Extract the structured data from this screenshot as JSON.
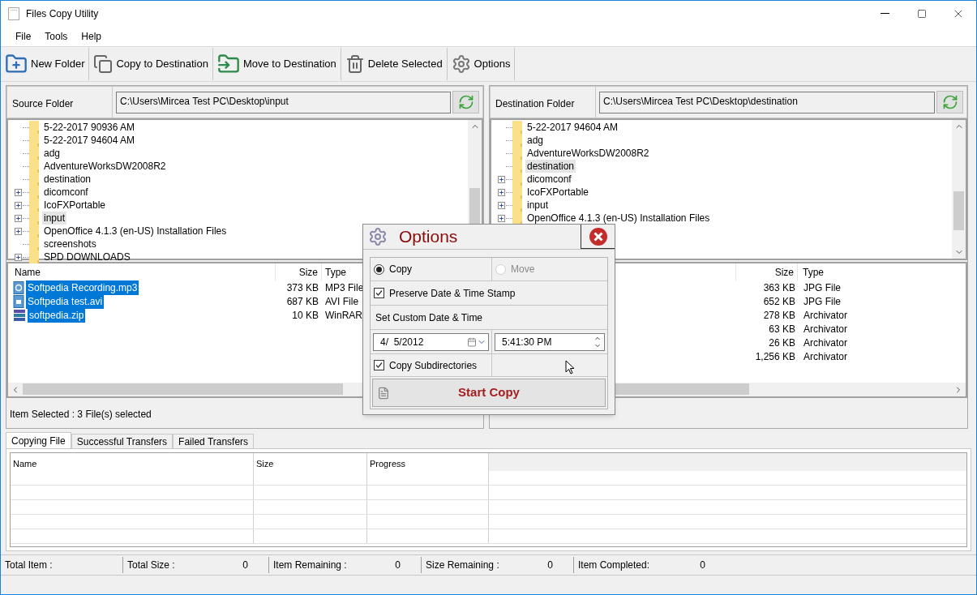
{
  "window": {
    "title": "Files Copy Utility"
  },
  "menu": [
    "File",
    "Tools",
    "Help"
  ],
  "toolbar": [
    {
      "label": "New Folder",
      "kind": "new-folder"
    },
    {
      "label": "Copy to Destination",
      "kind": "copy"
    },
    {
      "label": "Move to Destination",
      "kind": "move"
    },
    {
      "label": "Delete Selected",
      "kind": "delete"
    },
    {
      "label": "Options",
      "kind": "options"
    }
  ],
  "source": {
    "label": "Source Folder",
    "path": "C:\\Users\\Mircea Test PC\\Desktop\\input",
    "tree": [
      {
        "label": "5-22-2017 90936 AM",
        "expandable": false,
        "selected": false
      },
      {
        "label": "5-22-2017 94604 AM",
        "expandable": false,
        "selected": false
      },
      {
        "label": "adg",
        "expandable": false,
        "selected": false
      },
      {
        "label": "AdventureWorksDW2008R2",
        "expandable": false,
        "selected": false
      },
      {
        "label": "destination",
        "expandable": false,
        "selected": false
      },
      {
        "label": "dicomconf",
        "expandable": true,
        "selected": false
      },
      {
        "label": "IcoFXPortable",
        "expandable": true,
        "selected": false
      },
      {
        "label": "input",
        "expandable": true,
        "selected": true
      },
      {
        "label": "OpenOffice 4.1.3 (en-US) Installation Files",
        "expandable": true,
        "selected": false
      },
      {
        "label": "screenshots",
        "expandable": false,
        "selected": false
      },
      {
        "label": "SPD DOWNLOADS",
        "expandable": true,
        "selected": false
      }
    ],
    "files": {
      "columns": [
        "Name",
        "Size",
        "Type"
      ],
      "rows": [
        {
          "name": "Softpedia Recording.mp3",
          "size": "373 KB",
          "type": "MP3 File",
          "kind": "audio",
          "selected": true
        },
        {
          "name": "Softpedia test.avi",
          "size": "687 KB",
          "type": "AVI File",
          "kind": "video",
          "selected": true
        },
        {
          "name": "softpedia.zip",
          "size": "10 KB",
          "type": "WinRAR",
          "kind": "archive",
          "selected": true
        }
      ]
    },
    "status": "Item Selected :  3 File(s) selected"
  },
  "destination": {
    "label": "Destination Folder",
    "path": "C:\\Users\\Mircea Test PC\\Desktop\\destination",
    "tree": [
      {
        "label": "5-22-2017 94604 AM",
        "expandable": false,
        "selected": false
      },
      {
        "label": "adg",
        "expandable": false,
        "selected": false
      },
      {
        "label": "AdventureWorksDW2008R2",
        "expandable": false,
        "selected": false
      },
      {
        "label": "destination",
        "expandable": false,
        "selected": true
      },
      {
        "label": "dicomconf",
        "expandable": true,
        "selected": false
      },
      {
        "label": "IcoFXPortable",
        "expandable": true,
        "selected": false
      },
      {
        "label": "input",
        "expandable": true,
        "selected": false
      },
      {
        "label": "OpenOffice 4.1.3 (en-US) Installation Files",
        "expandable": true,
        "selected": false
      }
    ],
    "files": {
      "columns": [
        "Size",
        "Type"
      ],
      "rows": [
        {
          "size": "363 KB",
          "type": "JPG File"
        },
        {
          "size": "652 KB",
          "type": "JPG File"
        },
        {
          "size": "278 KB",
          "type": "Archivator"
        },
        {
          "size": "63 KB",
          "type": "Archivator"
        },
        {
          "size": "26 KB",
          "type": "Archivator"
        },
        {
          "size": "1,256 KB",
          "type": "Archivator"
        }
      ]
    }
  },
  "options_dialog": {
    "title": "Options",
    "modes": [
      {
        "label": "Copy",
        "selected": true,
        "disabled": false
      },
      {
        "label": "Move",
        "selected": false,
        "disabled": true
      }
    ],
    "preserve": {
      "label": "Preserve Date & Time Stamp",
      "checked": true
    },
    "custom_label": "Set Custom Date & Time",
    "date": "4/  5/2012",
    "time": "5:41:30 PM",
    "subdirs": {
      "label": "Copy Subdirectories",
      "checked": true
    },
    "start_button": "Start Copy"
  },
  "transfer_tabs": [
    {
      "label": "Copying File",
      "selected": true
    },
    {
      "label": "Successful Transfers",
      "selected": false
    },
    {
      "label": "Failed Transfers",
      "selected": false
    }
  ],
  "transfer_table": {
    "columns": [
      "Name",
      "Size",
      "Progress"
    ]
  },
  "status_bar": [
    {
      "label": "Total Item :"
    },
    {
      "label": "Total Size :",
      "value": "0"
    },
    {
      "label": "Item Remaining :",
      "value": "0"
    },
    {
      "label": "Size Remaining :",
      "value": "0"
    },
    {
      "label": "Item Completed:",
      "value": "0"
    }
  ]
}
